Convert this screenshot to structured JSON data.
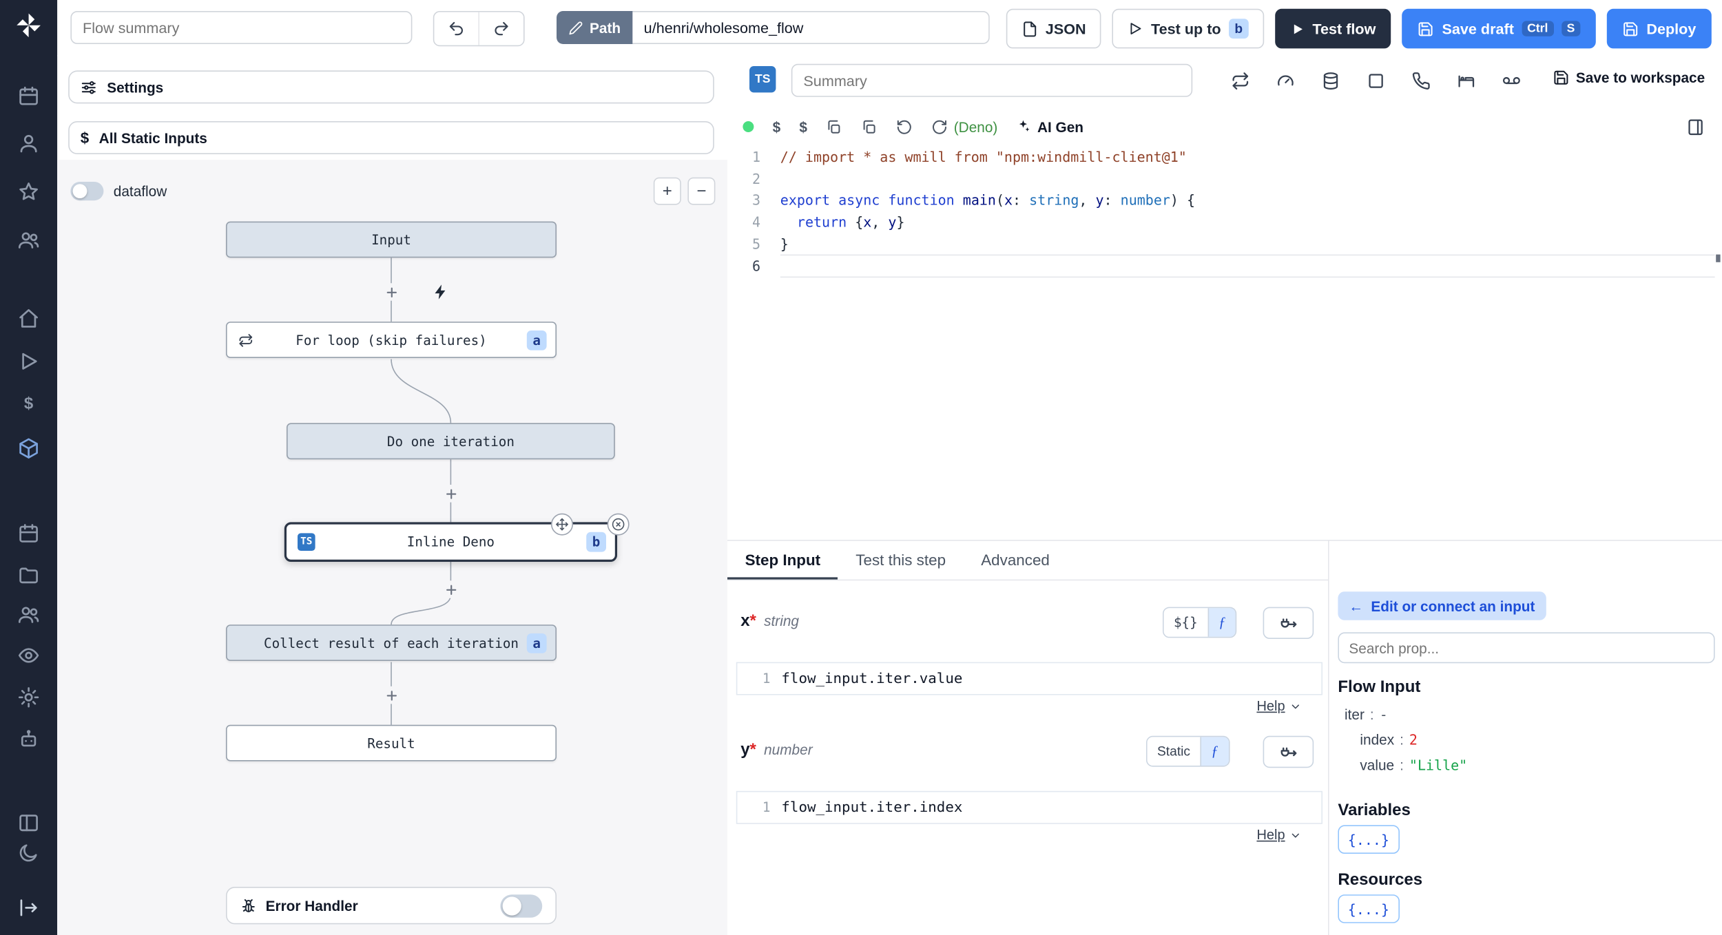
{
  "colors": {
    "accent_blue": "#3b82f6",
    "dark_navy": "#242e40",
    "badge_bg": "#bfdbfe",
    "badge_text": "#1e3a8a",
    "status_green": "#4ade80",
    "value_red": "#dc2626",
    "value_green": "#16a34a"
  },
  "topbar": {
    "flow_summary_placeholder": "Flow summary",
    "path_label": "Path",
    "path_value": "u/henri/wholesome_flow",
    "json_label": "JSON",
    "test_up_to_label": "Test up to",
    "test_up_to_badge": "b",
    "test_flow_label": "Test flow",
    "save_draft_label": "Save draft",
    "kbd_ctrl": "Ctrl",
    "kbd_s": "S",
    "deploy_label": "Deploy"
  },
  "sidebar": {
    "icons": [
      "windmill-logo",
      "calendar",
      "user",
      "star",
      "users",
      "home",
      "play",
      "dollar",
      "package",
      "calendar",
      "folder",
      "team",
      "eye",
      "settings",
      "bot",
      "panels",
      "moon",
      "expand"
    ]
  },
  "flow_panel": {
    "settings_label": "Settings",
    "static_inputs_label": "All Static Inputs",
    "dataflow_label": "dataflow",
    "zoom_in": "+",
    "zoom_out": "−",
    "nodes": {
      "input": "Input",
      "for_loop": "For loop (skip failures)",
      "for_loop_badge": "a",
      "iteration": "Do one iteration",
      "inline_deno": "Inline Deno",
      "inline_deno_badge": "b",
      "ts_badge": "TS",
      "collect": "Collect result of each iteration",
      "collect_badge": "a",
      "result": "Result"
    },
    "error_handler_label": "Error Handler"
  },
  "editor": {
    "ts_badge": "TS",
    "summary_placeholder": "Summary",
    "toolbar_icons": [
      "loop",
      "gauge",
      "database",
      "square",
      "phone",
      "sleep",
      "voicemail"
    ],
    "save_to_workspace": "Save to workspace",
    "runtime": "(Deno)",
    "ai_gen": "AI Gen",
    "code": {
      "lines": [
        [
          {
            "t": "// import * as wmill from \"npm:windmill-client@1\"",
            "c": "cm"
          }
        ],
        [],
        [
          {
            "t": "export",
            "c": "kw"
          },
          {
            "t": " ",
            "c": "pl"
          },
          {
            "t": "async",
            "c": "kw"
          },
          {
            "t": " ",
            "c": "pl"
          },
          {
            "t": "function",
            "c": "kw"
          },
          {
            "t": " ",
            "c": "pl"
          },
          {
            "t": "main",
            "c": "fn"
          },
          {
            "t": "(",
            "c": "pl"
          },
          {
            "t": "x",
            "c": "vr"
          },
          {
            "t": ": ",
            "c": "pl"
          },
          {
            "t": "string",
            "c": "ty"
          },
          {
            "t": ", ",
            "c": "pl"
          },
          {
            "t": "y",
            "c": "vr"
          },
          {
            "t": ": ",
            "c": "pl"
          },
          {
            "t": "number",
            "c": "ty"
          },
          {
            "t": ") {",
            "c": "pl"
          }
        ],
        [
          {
            "t": "  ",
            "c": "pl"
          },
          {
            "t": "return",
            "c": "kw"
          },
          {
            "t": " {",
            "c": "pl"
          },
          {
            "t": "x",
            "c": "vr"
          },
          {
            "t": ", ",
            "c": "pl"
          },
          {
            "t": "y",
            "c": "vr"
          },
          {
            "t": "}",
            "c": "pl"
          }
        ],
        [
          {
            "t": "}",
            "c": "pl"
          }
        ],
        []
      ]
    }
  },
  "step_panel": {
    "tabs": [
      {
        "label": "Step Input"
      },
      {
        "label": "Test this step"
      },
      {
        "label": "Advanced"
      }
    ],
    "fields": [
      {
        "name": "x",
        "star": "*",
        "type": "string",
        "toggle_left": "${}",
        "toggle_right": "ƒ",
        "line": "1",
        "expr": "flow_input.iter.value",
        "help": "Help"
      },
      {
        "name": "y",
        "star": "*",
        "type": "number",
        "toggle_left": "Static",
        "toggle_right": "ƒ",
        "line": "1",
        "expr": "flow_input.iter.index",
        "help": "Help"
      }
    ]
  },
  "prop_picker": {
    "edit_connect_label": "Edit or connect an input",
    "edit_connect_arrow": "←",
    "search_placeholder": "Search prop...",
    "flow_input_title": "Flow Input",
    "rows": [
      {
        "key": "iter",
        "sep": ":",
        "value": "-",
        "kind": "plain"
      },
      {
        "key": "index",
        "sep": ":",
        "value": "2",
        "kind": "num"
      },
      {
        "key": "value",
        "sep": ":",
        "value": "\"Lille\"",
        "kind": "str"
      }
    ],
    "variables_title": "Variables",
    "variables_chip": "{...}",
    "resources_title": "Resources",
    "resources_chip": "{...}"
  }
}
